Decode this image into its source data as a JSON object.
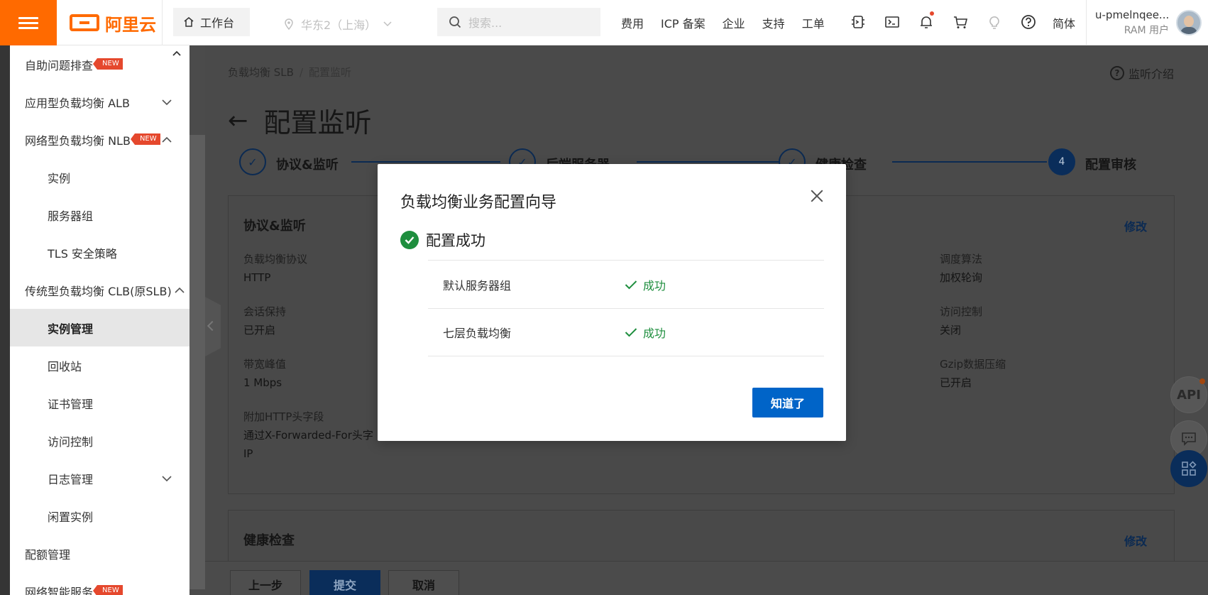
{
  "topbar": {
    "brand": "阿里云",
    "workbench": "工作台",
    "region": "华东2（上海）",
    "search_placeholder": "搜索...",
    "nav": [
      "费用",
      "ICP 备案",
      "企业",
      "支持",
      "工单"
    ],
    "lang": "简体",
    "user_name": "u-pmelnqee...",
    "user_role": "RAM 用户"
  },
  "sidebar": {
    "items": [
      {
        "label": "自助问题排查",
        "new": "NEW"
      },
      {
        "label": "应用型负载均衡 ALB"
      },
      {
        "label": "网络型负载均衡 NLB",
        "new": "NEW"
      },
      {
        "label": "实例"
      },
      {
        "label": "服务器组"
      },
      {
        "label": "TLS 安全策略"
      },
      {
        "label": "传统型负载均衡 CLB(原SLB)"
      },
      {
        "label": "实例管理"
      },
      {
        "label": "回收站"
      },
      {
        "label": "证书管理"
      },
      {
        "label": "访问控制"
      },
      {
        "label": "日志管理"
      },
      {
        "label": "闲置实例"
      },
      {
        "label": "配额管理"
      },
      {
        "label": "网络智能服务",
        "new": "NEW"
      }
    ]
  },
  "main": {
    "breadcrumb": [
      "负载均衡 SLB",
      "/",
      "配置监听"
    ],
    "help_link": "监听介绍",
    "title": "配置监听",
    "steps": [
      {
        "label": "协议&监听"
      },
      {
        "label": "后端服务器"
      },
      {
        "label": "健康检查"
      },
      {
        "label": "配置审核",
        "num": "4"
      }
    ],
    "card1": {
      "title": "协议&监听",
      "edit": "修改",
      "fields": [
        {
          "k": "负载均衡协议",
          "v": "HTTP"
        },
        {
          "k": "调度算法",
          "v": "加权轮询"
        },
        {
          "k": "会话保持",
          "v": "已开启"
        },
        {
          "k": "访问控制",
          "v": "关闭"
        },
        {
          "k": "带宽峰值",
          "v": "1 Mbps"
        },
        {
          "k": "Gzip数据压缩",
          "v": "已开启"
        },
        {
          "k": "附加HTTP头字段",
          "v": "通过X-Forwarded-For头字",
          "v2": "IP"
        }
      ]
    },
    "card2": {
      "title": "健康检查",
      "edit": "修改"
    },
    "footer": {
      "prev": "上一步",
      "submit": "提交",
      "cancel": "取消"
    },
    "floating": {
      "api": "API"
    }
  },
  "modal": {
    "title": "负载均衡业务配置向导",
    "success": "配置成功",
    "rows": [
      {
        "name": "默认服务器组",
        "status": "成功"
      },
      {
        "name": "七层负载均衡",
        "status": "成功"
      }
    ],
    "ok": "知道了"
  },
  "colors": {
    "brand": "#ff6a00",
    "primary": "#0064c8",
    "success": "#1e8e3e",
    "new_tag": "#e5482d"
  }
}
